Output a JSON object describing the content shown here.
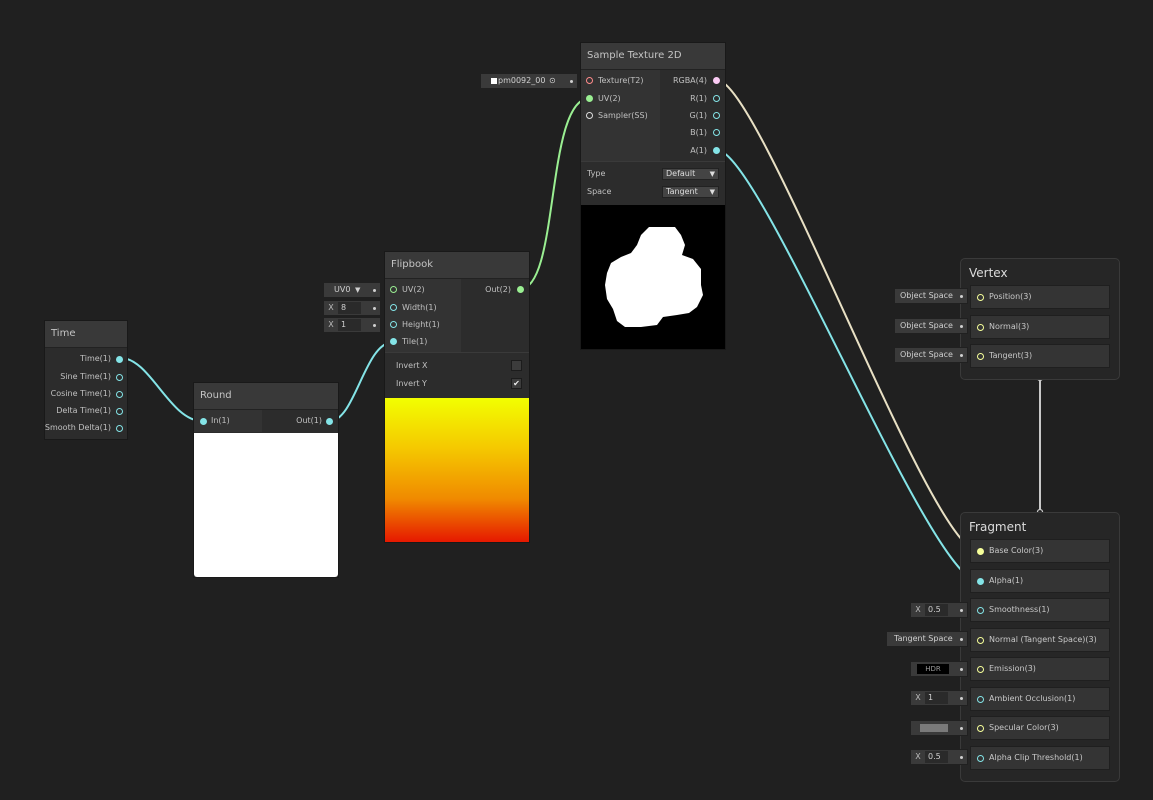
{
  "colors": {
    "float": "#84e4e7",
    "vector2": "#9aef92",
    "vector3": "#f6ff9a",
    "vector4": "#fbcbf4",
    "texture": "#ff8b8b",
    "sampler": "#dcdcdc",
    "wire_connector": "#c8c8c8"
  },
  "time_node": {
    "title": "Time",
    "outputs": [
      "Time(1)",
      "Sine Time(1)",
      "Cosine Time(1)",
      "Delta Time(1)",
      "Smooth Delta(1)"
    ]
  },
  "round_node": {
    "title": "Round",
    "input": "In(1)",
    "output": "Out(1)"
  },
  "flipbook_node": {
    "title": "Flipbook",
    "inputs": [
      "UV(2)",
      "Width(1)",
      "Height(1)",
      "Tile(1)"
    ],
    "output": "Out(2)",
    "uv_dropdown": "UV0",
    "width_x": "X",
    "width_value": "8",
    "height_x": "X",
    "height_value": "1",
    "invert_x_label": "Invert X",
    "invert_x_checked": false,
    "invert_y_label": "Invert Y",
    "invert_y_checked": true,
    "check_glyph": "✔"
  },
  "sample_texture_node": {
    "title": "Sample Texture 2D",
    "inputs": [
      "Texture(T2)",
      "UV(2)",
      "Sampler(SS)"
    ],
    "outputs": [
      "RGBA(4)",
      "R(1)",
      "G(1)",
      "B(1)",
      "A(1)"
    ],
    "texture_field": "pm0092_00",
    "type_label": "Type",
    "type_value": "Default",
    "space_label": "Space",
    "space_value": "Tangent"
  },
  "vertex_block": {
    "title": "Vertex",
    "slots": [
      {
        "label": "Position(3)",
        "input": "Object Space"
      },
      {
        "label": "Normal(3)",
        "input": "Object Space"
      },
      {
        "label": "Tangent(3)",
        "input": "Object Space"
      }
    ]
  },
  "fragment_block": {
    "title": "Fragment",
    "slots": [
      {
        "label": "Base Color(3)",
        "input": ""
      },
      {
        "label": "Alpha(1)",
        "input": ""
      },
      {
        "label": "Smoothness(1)",
        "input_x": "X",
        "input": "0.5"
      },
      {
        "label": "Normal (Tangent Space)(3)",
        "input": "Tangent Space"
      },
      {
        "label": "Emission(3)",
        "input": "HDR"
      },
      {
        "label": "Ambient Occlusion(1)",
        "input_x": "X",
        "input": "1"
      },
      {
        "label": "Specular Color(3)",
        "input": ""
      },
      {
        "label": "Alpha Clip Threshold(1)",
        "input_x": "X",
        "input": "0.5"
      }
    ]
  }
}
